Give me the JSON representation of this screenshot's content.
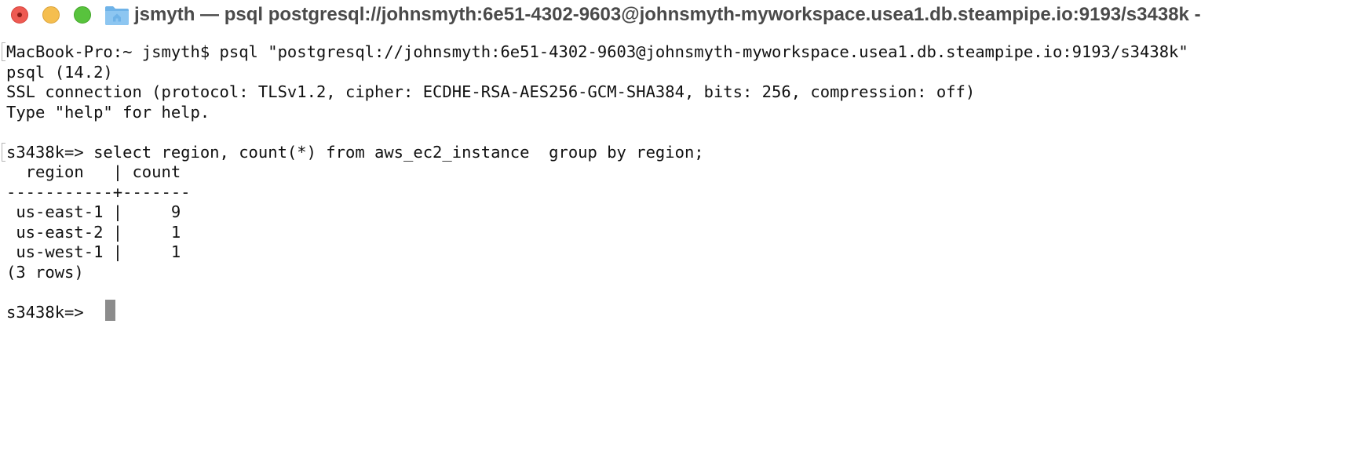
{
  "window": {
    "title": "jsmyth — psql postgresql://johnsmyth:6e51-4302-9603@johnsmyth-myworkspace.usea1.db.steampipe.io:9193/s3438k -",
    "folder_icon": "folder-home-icon",
    "traffic_lights": {
      "close_color": "#ee5a52",
      "minimize_color": "#f5be4f",
      "zoom_color": "#58c33d"
    }
  },
  "terminal": {
    "lines": [
      "MacBook-Pro:~ jsmyth$ psql \"postgresql://johnsmyth:6e51-4302-9603@johnsmyth-myworkspace.usea1.db.steampipe.io:9193/s3438k\"",
      "psql (14.2)",
      "SSL connection (protocol: TLSv1.2, cipher: ECDHE-RSA-AES256-GCM-SHA384, bits: 256, compression: off)",
      "Type \"help\" for help.",
      "",
      "s3438k=> select region, count(*) from aws_ec2_instance  group by region;",
      "  region   | count",
      "-----------+-------",
      " us-east-1 |     9",
      " us-east-2 |     1",
      " us-west-1 |     1",
      "(3 rows)",
      "",
      "s3438k=> "
    ],
    "prompt_marks": [
      0,
      5
    ],
    "cursor_color": "#8c8c8c"
  }
}
